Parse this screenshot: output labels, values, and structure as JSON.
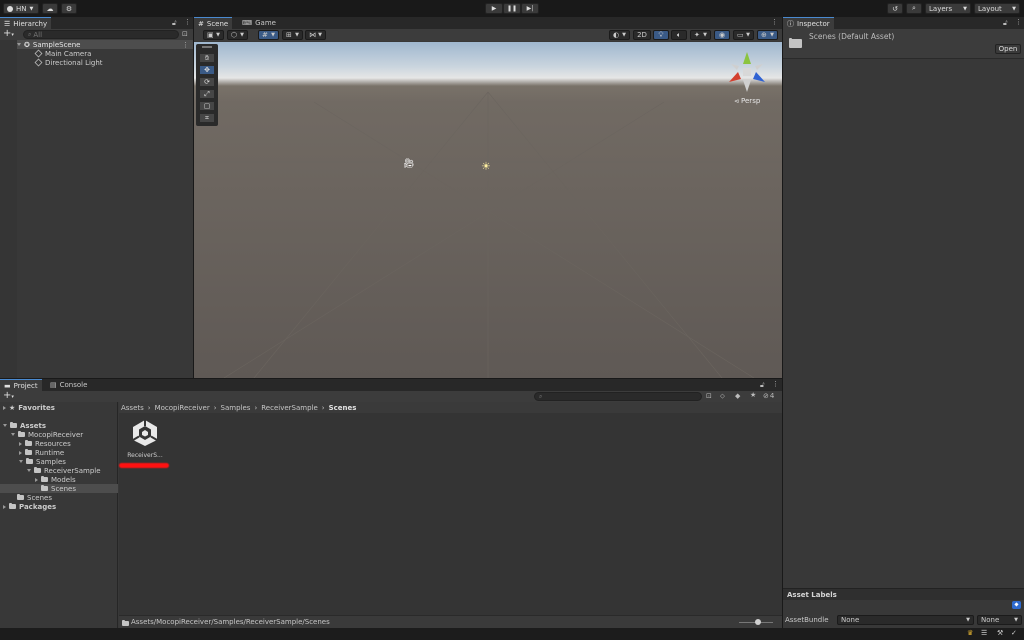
{
  "topbar": {
    "account": "HN",
    "layers": "Layers",
    "layout": "Layout"
  },
  "hierarchy": {
    "tab": "Hierarchy",
    "search_placeholder": "All",
    "scene": "SampleScene",
    "items": [
      "Main Camera",
      "Directional Light"
    ]
  },
  "scene_view": {
    "tabs": [
      "Scene",
      "Game"
    ],
    "twod": "2D",
    "persp": "Persp",
    "gizmo_colors": {
      "x": "#d33f2f",
      "y": "#8bc43f",
      "z": "#2f62d3"
    }
  },
  "inspector": {
    "tab": "Inspector",
    "asset_title": "Scenes (Default Asset)",
    "open": "Open",
    "asset_labels": "Asset Labels",
    "asset_bundle_label": "AssetBundle",
    "bundle_value": "None",
    "variant_value": "None"
  },
  "project": {
    "tabs": [
      "Project",
      "Console"
    ],
    "favorites": "Favorites",
    "assets": "Assets",
    "packages": "Packages",
    "tree": [
      {
        "label": "MocopiReceiver",
        "depth": 1,
        "open": true
      },
      {
        "label": "Resources",
        "depth": 2,
        "open": false
      },
      {
        "label": "Runtime",
        "depth": 2,
        "open": false
      },
      {
        "label": "Samples",
        "depth": 2,
        "open": true
      },
      {
        "label": "ReceiverSample",
        "depth": 3,
        "open": true
      },
      {
        "label": "Models",
        "depth": 4,
        "open": false
      },
      {
        "label": "Scenes",
        "depth": 4,
        "open": null,
        "selected": true
      },
      {
        "label": "Scenes",
        "depth": 1,
        "open": null
      }
    ],
    "breadcrumb": [
      "Assets",
      "MocopiReceiver",
      "Samples",
      "ReceiverSample",
      "Scenes"
    ],
    "file_label": "ReceiverS...",
    "hidden_count": "4",
    "path": "Assets/MocopiReceiver/Samples/ReceiverSample/Scenes"
  }
}
